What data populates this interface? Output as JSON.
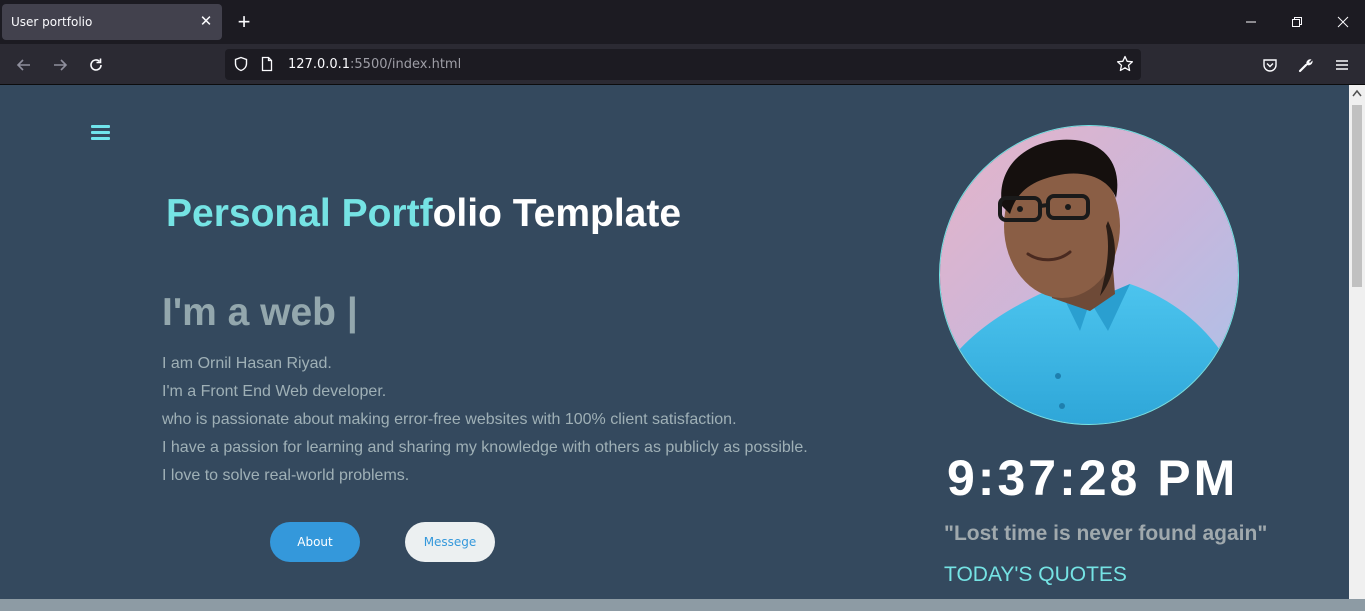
{
  "browser": {
    "tab_title": "User portfolio",
    "url_host": "127.0.0.1",
    "url_rest": ":5500/index.html"
  },
  "hero": {
    "title_accent": "Personal Portf",
    "title_rest": "olio Template",
    "typed_text": "I'm a web |"
  },
  "bio": {
    "lines": [
      "I am Ornil Hasan Riyad.",
      "I'm a Front End Web developer.",
      "who is passionate about making error-free websites with 100% client satisfaction.",
      "I have a passion for learning and sharing my knowledge with others as publicly as possible.",
      "I love to solve real-world problems."
    ]
  },
  "buttons": {
    "about": "About",
    "message": "Messege"
  },
  "sidebar": {
    "clock": "9:37:28 PM",
    "quote": "\"Lost time is never found again\"",
    "quote_label": "TODAY'S QUOTES"
  },
  "colors": {
    "page_bg": "#34495e",
    "accent": "#75e3e4",
    "button_blue": "#3498db"
  }
}
